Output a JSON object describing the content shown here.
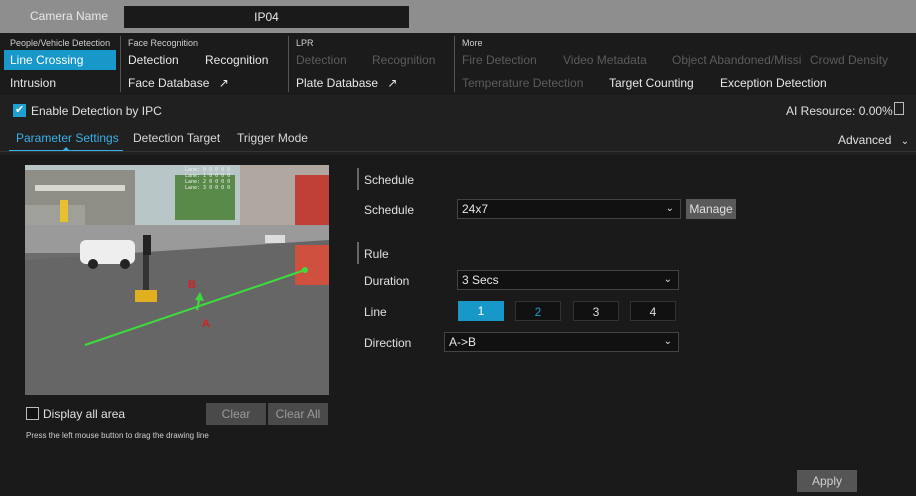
{
  "camera": {
    "label": "Camera Name",
    "value": "IP04"
  },
  "categories": {
    "people_vehicle": {
      "heading": "People/Vehicle Detection",
      "items": [
        "Line Crossing",
        "Intrusion"
      ]
    },
    "face": {
      "heading": "Face Recognition",
      "items": [
        "Detection",
        "Recognition",
        "Face Database"
      ]
    },
    "lpr": {
      "heading": "LPR",
      "items": [
        "Detection",
        "Recognition",
        "Plate Database"
      ]
    },
    "more": {
      "heading": "More",
      "items": [
        "Fire Detection",
        "Video Metadata",
        "Object Abandoned/Missi",
        "Crowd Density",
        "Temperature Detection",
        "Target Counting",
        "Exception Detection"
      ]
    }
  },
  "ipc": {
    "enable_label": "Enable Detection by IPC",
    "enabled": true,
    "ai_resource": "AI Resource: 0.00%"
  },
  "tabs": [
    "Parameter Settings",
    "Detection Target",
    "Trigger Mode"
  ],
  "advanced_label": "Advanced",
  "video": {
    "overlay_lines": [
      "Lane: 0 0 0 0 0",
      "Lane: 1 0 0 0 0",
      "Lane: 2 0 0 0 0",
      "Lane: 3 0 0 0 0"
    ],
    "point_a": "A",
    "point_b": "B",
    "display_all_label": "Display all area",
    "clear_label": "Clear",
    "clear_all_label": "Clear All",
    "hint": "Press the left mouse button to drag the drawing line"
  },
  "schedule": {
    "section_title": "Schedule",
    "label": "Schedule",
    "value": "24x7",
    "manage_label": "Manage"
  },
  "rule": {
    "section_title": "Rule",
    "duration_label": "Duration",
    "duration_value": "3 Secs",
    "line_label": "Line",
    "lines": [
      "1",
      "2",
      "3",
      "4"
    ],
    "active_line": "1",
    "direction_label": "Direction",
    "direction_value": "A->B"
  },
  "apply_label": "Apply",
  "colors": {
    "accent": "#1898c8",
    "line": "#3ddc3d",
    "marker": "#d42020"
  },
  "icons": {
    "external_link": "arrow-up-right-icon",
    "doc": "document-icon",
    "chevron": "chevron-down-icon",
    "check": "check-icon"
  }
}
